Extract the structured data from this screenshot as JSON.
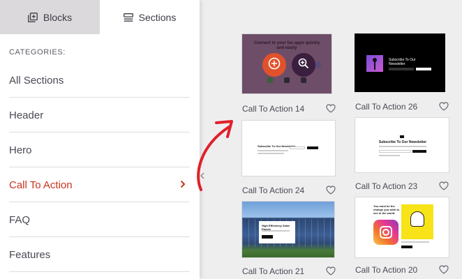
{
  "tabs": [
    {
      "label": "Blocks",
      "icon": "blocks-icon"
    },
    {
      "label": "Sections",
      "icon": "sections-icon"
    }
  ],
  "categories_heading": "CATEGORIES:",
  "categories": [
    "All Sections",
    "Header",
    "Hero",
    "Call To Action",
    "FAQ",
    "Features"
  ],
  "active_category": "Call To Action",
  "colors": {
    "accent": "#c9331e",
    "add_button": "#e0522c",
    "preview_button": "#3a1f3f"
  },
  "sections": [
    {
      "label": "Call To Action 14",
      "thumb": {
        "title": "Connect to your fav apps quickly and easily"
      },
      "hover_actions": [
        "add-icon",
        "zoom-icon"
      ]
    },
    {
      "label": "Call To Action 26",
      "thumb": {
        "title": "Subscribe To Our Newsletter"
      }
    },
    {
      "label": "Call To Action 24",
      "thumb": {
        "title": "Subscribe To Our Newsletter"
      }
    },
    {
      "label": "Call To Action 23",
      "thumb": {
        "title": "Subscribe To Our Newsletter"
      }
    },
    {
      "label": "Call To Action 21",
      "thumb": {
        "title": "High Efficiency Solar Panels"
      }
    },
    {
      "label": "Call To Action 20",
      "thumb": {
        "title": "You must be the change you wish to see in the world."
      }
    }
  ]
}
